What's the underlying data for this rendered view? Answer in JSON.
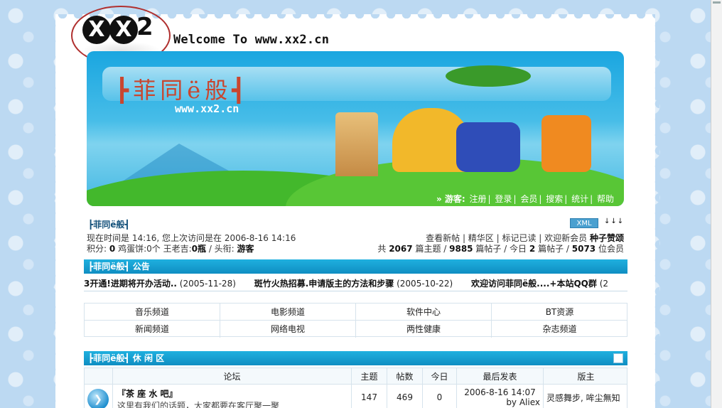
{
  "header": {
    "logo_text": "XX2",
    "welcome": "Welcome To www.xx2.cn"
  },
  "banner": {
    "title_cn": "┣菲同ё般┫",
    "url": "www.xx2.cn",
    "guest_label": "» 游客:",
    "nav": [
      "注册",
      "登录",
      "会员",
      "搜索",
      "统计",
      "帮助"
    ]
  },
  "board": {
    "title": "┣菲同ё般┫",
    "xml_badge": "XML",
    "arrows": "↓↓↓",
    "time_line": "现在时间是 14:16, 您上次访问是在 2006-8-16 14:16",
    "points_line": {
      "label_points": "积分:",
      "points": "0",
      "label_eggs": "鸡蛋饼:",
      "eggs": "0个",
      "label_wine": "王老吉:",
      "wine": "0瓶",
      "label_title": "/ 头衔:",
      "title": "游客"
    },
    "links_line": "查看新帖 | 精华区 | 标记已读 | 欢迎新会员",
    "new_member": "种子赞颂",
    "stats_line": {
      "prefix": "共",
      "topics": "2067",
      "topics_label": "篇主题 /",
      "posts": "9885",
      "posts_label": "篇帖子 / 今日",
      "today": "2",
      "today_label": "篇帖子 /",
      "members": "5073",
      "members_label": "位会员"
    }
  },
  "announcements": {
    "section_title": "┣菲同ё般┫ 公告",
    "items": [
      {
        "title": "3开通!进期将开办活动..",
        "date": "(2005-11-28)"
      },
      {
        "title": "斑竹火热招募.申请版主的方法和步骤",
        "date": "(2005-10-22)"
      },
      {
        "title": "欢迎访问菲同ё般....+本站QQ群",
        "date": "(2"
      }
    ]
  },
  "channels": [
    [
      "音乐频道",
      "电影频道",
      "软件中心",
      "BT资源"
    ],
    [
      "新闻频道",
      "网络电视",
      "两性健康",
      "杂志频道"
    ]
  ],
  "leisure": {
    "section_title": "┣菲同ё般┫ 休 闲 区",
    "headers": [
      "论坛",
      "主题",
      "帖数",
      "今日",
      "最后发表",
      "版主"
    ],
    "rows": [
      {
        "name": "『茶 座 水 吧』",
        "desc": "这里有我们的话题，大家都要在客厅聚一聚",
        "topics": "147",
        "posts": "469",
        "today": "0",
        "last_time": "2006-8-16 14:07",
        "last_by": "by Aliex",
        "moderators": "灵感舞步, 哞尘無知"
      }
    ]
  }
}
